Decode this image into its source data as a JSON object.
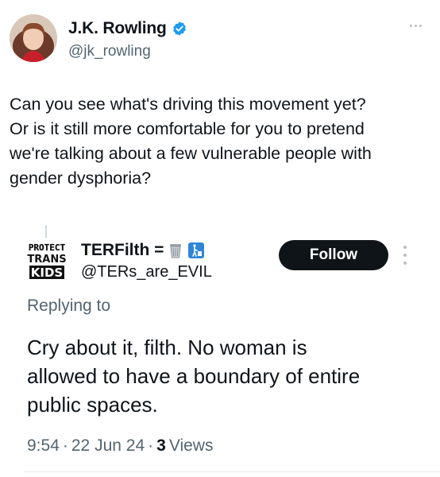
{
  "author": {
    "name": "J.K. Rowling",
    "handle": "@jk_rowling",
    "verified": true,
    "verified_color": "#1d9bf0"
  },
  "tweet": {
    "lines": [
      "Can you see what's driving this movement yet?",
      "Or is it still more comfortable for you to pretend",
      "we're talking about a few vulnerable people with",
      "gender dysphoria?"
    ]
  },
  "quoted": {
    "avatar_text": [
      "PROTECT",
      "TRANS",
      "KIDS"
    ],
    "name": "TERFilth =",
    "name_emojis": [
      "wastebasket-icon",
      "put-litter-in-bin-icon"
    ],
    "handle": "@TERs_are_EVIL",
    "follow_label": "Follow",
    "replying_to": "Replying to",
    "lines": [
      "Cry about it, filth. No woman is",
      "allowed to have a boundary of entire",
      "public spaces."
    ],
    "time": "9:54",
    "separator": "·",
    "date": "22 Jun 24",
    "views_count": "3",
    "views_label": "Views"
  },
  "colors": {
    "text": "#0f1419",
    "secondary": "#536471",
    "button_bg": "#0f1419"
  }
}
